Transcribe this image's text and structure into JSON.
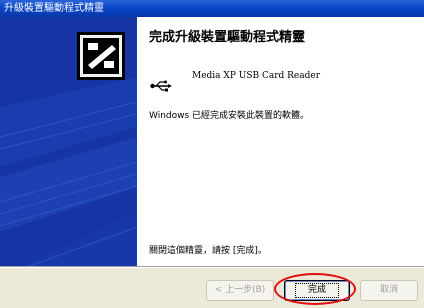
{
  "window": {
    "title": "升級裝置驅動程式精靈"
  },
  "wizard": {
    "heading": "完成升級裝置驅動程式精靈",
    "device_name": "Media XP USB Card Reader",
    "status_text": "Windows 已經完成安裝此裝置的軟體。",
    "close_hint": "關閉這個精靈，請按 [完成]。"
  },
  "buttons": {
    "back_label": "< 上一步(B)",
    "finish_label": "完成",
    "cancel_label": "取消"
  },
  "icons": {
    "wizard": "hardware-card-icon",
    "device": "usb-icon"
  },
  "colors": {
    "titlebar": "#0a48c8",
    "side_panel": "#1634a4",
    "highlight_circle": "#e01010"
  }
}
